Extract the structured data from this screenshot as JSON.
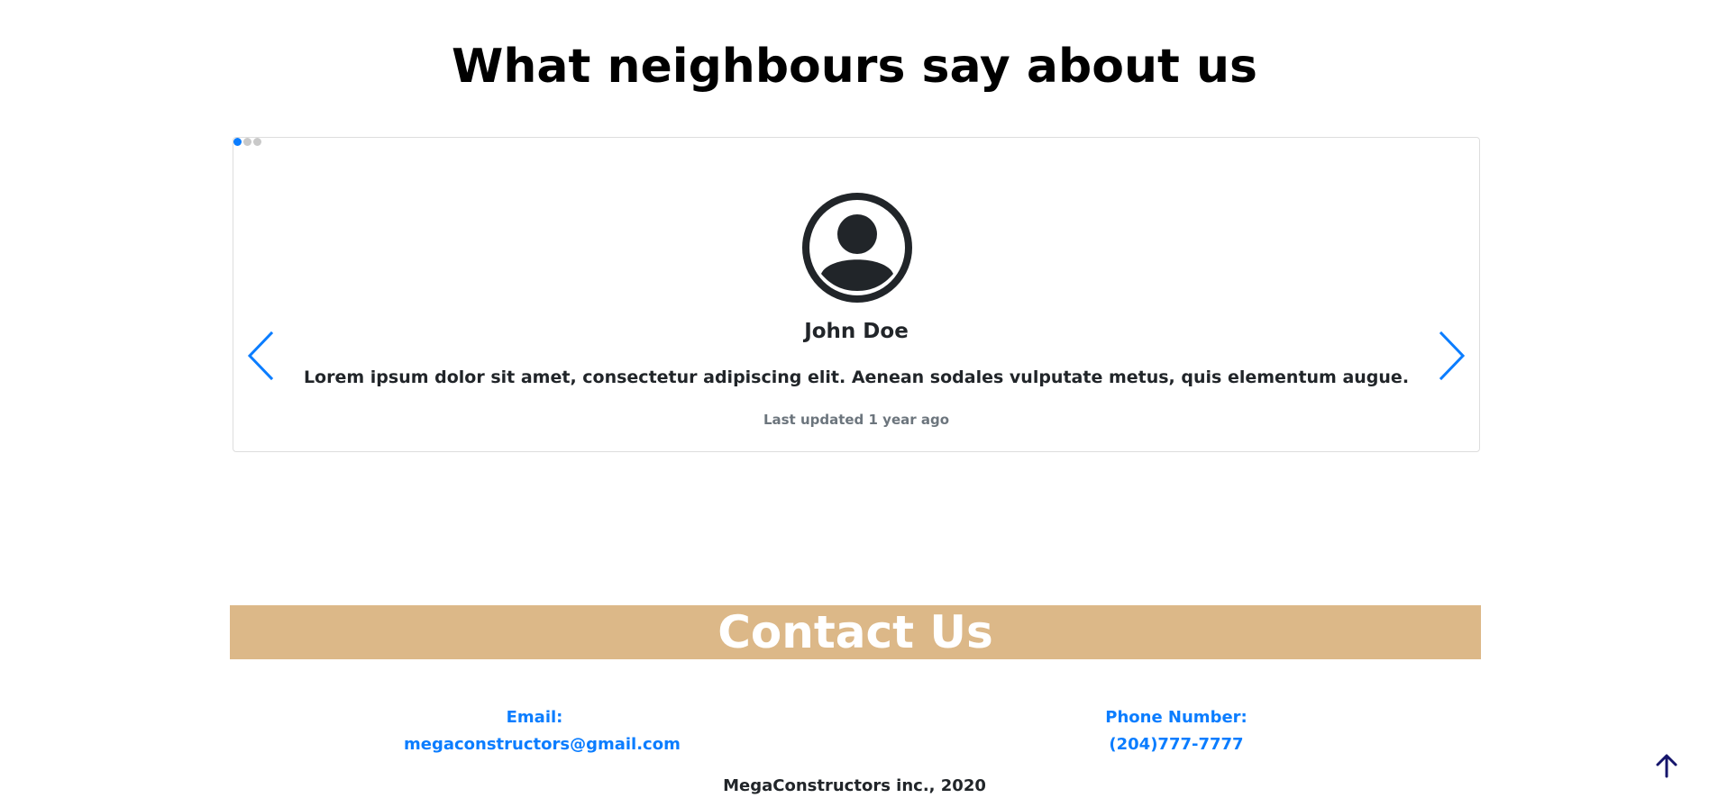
{
  "testimonials": {
    "title": "What neighbours say about us",
    "reviewer_name": "John Doe",
    "review_text": "Lorem ipsum dolor sit amet, consectetur adipiscing elit. Aenean sodales vulputate metus, quis elementum augue.",
    "updated_text": "Last updated 1 year ago",
    "icons": {
      "avatar": "user-circle-icon",
      "previous": "chevron-left-icon",
      "next": "chevron-right-icon"
    },
    "indicator_colors": {
      "active": "#0b7dff",
      "inactive": "#c9c9c9"
    },
    "active_slide": 1,
    "slide_count": 3
  },
  "contact": {
    "title": "Contact Us",
    "email_label": "Email:",
    "email_value": "megaconstructors@gmail.com",
    "phone_label": "Phone Number:",
    "phone_value": "(204)777-7777",
    "banner_color": "#dcb888",
    "link_color": "#0b7dff"
  },
  "footer": {
    "text": "MegaConstructors inc., 2020"
  },
  "scroll_top": {
    "icon": "arrow-up-icon"
  }
}
